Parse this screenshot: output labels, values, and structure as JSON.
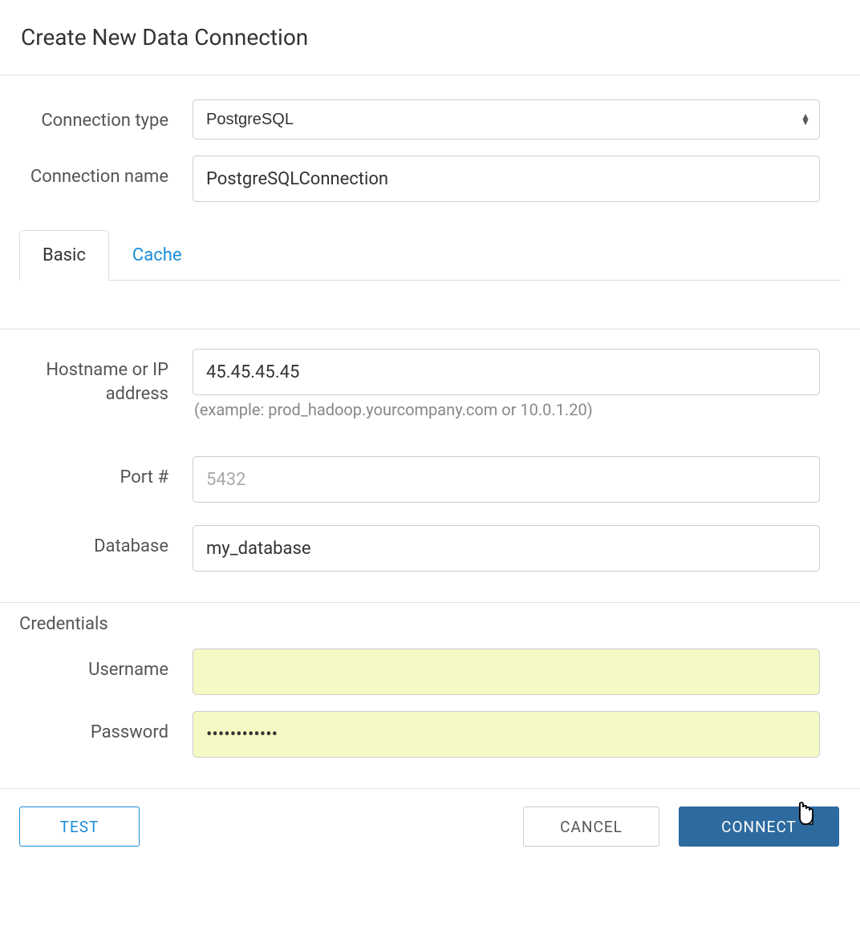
{
  "dialog": {
    "title": "Create New Data Connection"
  },
  "form": {
    "connection_type": {
      "label": "Connection type",
      "value": "PostgreSQL"
    },
    "connection_name": {
      "label": "Connection name",
      "value": "PostgreSQLConnection"
    }
  },
  "tabs": {
    "basic": "Basic",
    "cache": "Cache"
  },
  "basic": {
    "hostname": {
      "label": "Hostname or IP address",
      "value": "45.45.45.45",
      "help": "(example: prod_hadoop.yourcompany.com or 10.0.1.20)"
    },
    "port": {
      "label": "Port #",
      "placeholder": "5432",
      "value": ""
    },
    "database": {
      "label": "Database",
      "value": "my_database"
    }
  },
  "credentials": {
    "section_label": "Credentials",
    "username": {
      "label": "Username",
      "value": ""
    },
    "password": {
      "label": "Password",
      "value": "••••••••••••"
    }
  },
  "footer": {
    "test": "TEST",
    "cancel": "CANCEL",
    "connect": "CONNECT"
  }
}
